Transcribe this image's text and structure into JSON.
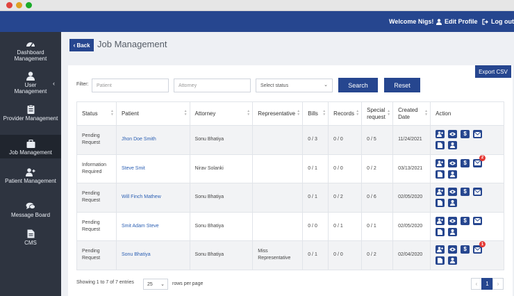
{
  "colors": {
    "brand": "#26468f",
    "sidebar": "#2e3440",
    "link": "#2b5fb3",
    "badge": "#e53935"
  },
  "window": {
    "dots": [
      "#e0443e",
      "#dea123",
      "#1aab29"
    ]
  },
  "topbar": {
    "welcome": "Welcome Nigs!",
    "edit_profile": "Edit Profile",
    "logout": "Log out"
  },
  "sidebar": {
    "items": [
      {
        "label": "Dashboard Management",
        "icon": "dashboard-icon"
      },
      {
        "label": "User Management",
        "icon": "user-icon"
      },
      {
        "label": "Provider Management",
        "icon": "provider-icon"
      },
      {
        "label": "Job Management",
        "icon": "briefcase-icon",
        "active": true
      },
      {
        "label": "Patient Management",
        "icon": "patient-icon"
      },
      {
        "label": "Message Board",
        "icon": "chat-icon"
      },
      {
        "label": "CMS",
        "icon": "document-icon"
      }
    ]
  },
  "header": {
    "back_label": "Back",
    "title": "Job Management"
  },
  "toolbar": {
    "export_label": "Export CSV"
  },
  "filters": {
    "label": "Filter:",
    "patient_placeholder": "Patient",
    "attorney_placeholder": "Attorney",
    "status_value": "Select status",
    "search_label": "Search",
    "reset_label": "Reset"
  },
  "table": {
    "headers": [
      "Status",
      "Patient",
      "Attorney",
      "Representative",
      "Bills",
      "Records",
      "Special request",
      "Created Date",
      "Action"
    ],
    "rows": [
      {
        "status": "Pending Request",
        "patient": "Jhon Doe Smith",
        "attorney": "Sonu Bhatiya",
        "representative": "",
        "bills": "0 / 3",
        "records": "0 / 0",
        "special": "0 / 5",
        "date": "11/24/2021",
        "badge": ""
      },
      {
        "status": "Information Required",
        "patient": "Steve Smit",
        "attorney": "Nirav Solanki",
        "representative": "",
        "bills": "0 / 1",
        "records": "0 / 0",
        "special": "0 / 2",
        "date": "03/13/2021",
        "badge": "2"
      },
      {
        "status": "Pending Request",
        "patient": "Will Finch Mathew",
        "attorney": "Sonu Bhatiya",
        "representative": "",
        "bills": "0 / 1",
        "records": "0 / 2",
        "special": "0 / 6",
        "date": "02/05/2020",
        "badge": ""
      },
      {
        "status": "Pending Request",
        "patient": "Smit Adam Steve",
        "attorney": "Sonu Bhatiya",
        "representative": "",
        "bills": "0 / 0",
        "records": "0 / 1",
        "special": "0 / 1",
        "date": "02/05/2020",
        "badge": ""
      },
      {
        "status": "Pending Request",
        "patient": "Sonu Bhatiya",
        "attorney": "Sonu Bhatiya",
        "representative": "Miss Representative",
        "bills": "0 / 1",
        "records": "0 / 0",
        "special": "0 / 2",
        "date": "02/04/2020",
        "badge": "1"
      }
    ],
    "action_icons": [
      "add-user-icon",
      "view-icon",
      "dollar-icon",
      "mail-icon",
      "document-icon",
      "person-icon"
    ]
  },
  "footer": {
    "showing": "Showing 1 to 7 of 7 entries",
    "per_page": "25",
    "rows_label": "rows per page",
    "prev": "‹",
    "page": "1",
    "next": "›"
  }
}
